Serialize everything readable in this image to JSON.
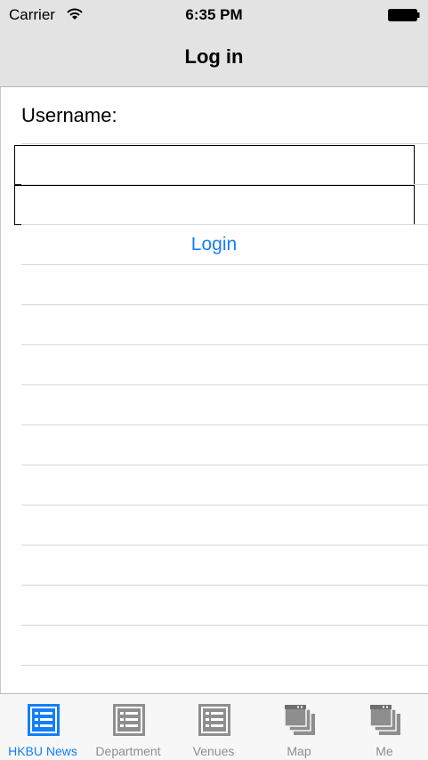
{
  "status_bar": {
    "carrier": "Carrier",
    "time": "6:35 PM",
    "wifi_icon": "wifi-icon",
    "battery_icon": "battery-full-icon"
  },
  "nav_bar": {
    "title": "Log in"
  },
  "form": {
    "username_label": "Username:",
    "username_value": "",
    "password_value": "",
    "login_label": "Login"
  },
  "tab_bar": {
    "tabs": [
      {
        "label": "HKBU News",
        "icon": "list-icon",
        "active": true
      },
      {
        "label": "Department",
        "icon": "list-icon",
        "active": false
      },
      {
        "label": "Venues",
        "icon": "list-icon",
        "active": false
      },
      {
        "label": "Map",
        "icon": "stacked-windows-icon",
        "active": false
      },
      {
        "label": "Me",
        "icon": "stacked-windows-icon",
        "active": false
      }
    ]
  },
  "colors": {
    "accent": "#147efb",
    "bar_background": "#e3e3e3",
    "inactive_tab": "#8e8e8e"
  }
}
